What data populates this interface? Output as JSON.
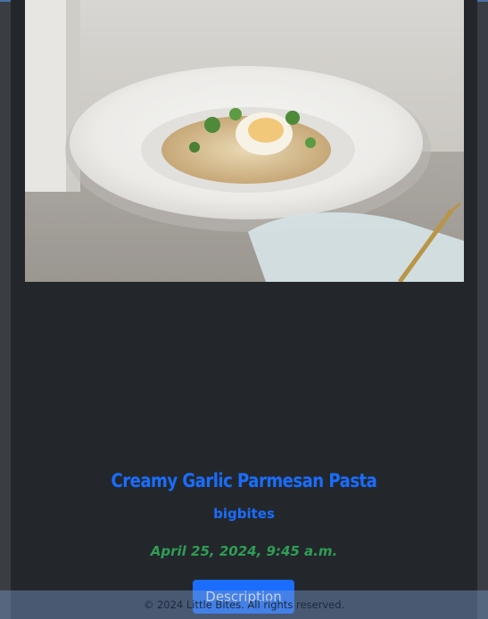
{
  "post": {
    "title": "Creamy Garlic Parmesan Pasta",
    "author": "bigbites",
    "date": "April 25, 2024, 9:45 a.m.",
    "description_button": "Description"
  },
  "footer": {
    "text": "© 2024 Little Bites. All rights reserved."
  },
  "colors": {
    "accent": "#1a6dff",
    "date": "#2e9e54",
    "card": "#23272c",
    "background": "#3a3e44"
  }
}
